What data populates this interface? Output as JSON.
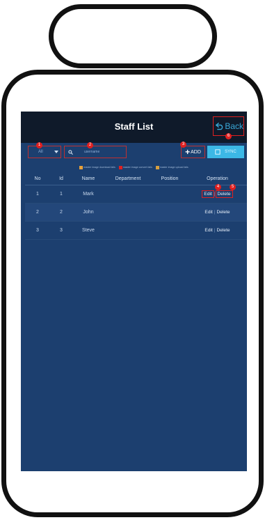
{
  "header": {
    "title": "Staff List",
    "back_label": "Back"
  },
  "markers": {
    "m1": "1",
    "m2": "2",
    "m3": "3",
    "m4": "4",
    "m5": "5",
    "m6": "6"
  },
  "toolbar": {
    "filter_value": "All",
    "search_placeholder": "username",
    "add_label": "ADD",
    "sync_label": "SYNC"
  },
  "legend": [
    {
      "label": "master image download fails",
      "color": "#e8a13a"
    },
    {
      "label": "master image convert fails",
      "color": "#e02020"
    },
    {
      "label": "master image upload fails",
      "color": "#d8a040"
    }
  ],
  "table": {
    "headers": [
      "No",
      "Id",
      "Name",
      "Department",
      "Position",
      "Operation"
    ],
    "rows": [
      {
        "no": "1",
        "id": "1",
        "name": "Mark",
        "department": "",
        "position": "",
        "edit": "Edit",
        "delete": "Delete"
      },
      {
        "no": "2",
        "id": "2",
        "name": "John",
        "department": "",
        "position": "",
        "edit": "Edit",
        "delete": "Delete"
      },
      {
        "no": "3",
        "id": "3",
        "name": "Steve",
        "department": "",
        "position": "",
        "edit": "Edit",
        "delete": "Delete"
      }
    ]
  },
  "icons": {
    "back": "back-arrow-icon",
    "search": "search-icon",
    "sync": "sync-icon",
    "add": "plus-icon",
    "dropdown": "chevron-down-icon"
  },
  "colors": {
    "screen_bg": "#1c3f6f",
    "titlebar_bg": "#0f1a2a",
    "accent": "#3cb8e6",
    "marker": "#e02020"
  }
}
